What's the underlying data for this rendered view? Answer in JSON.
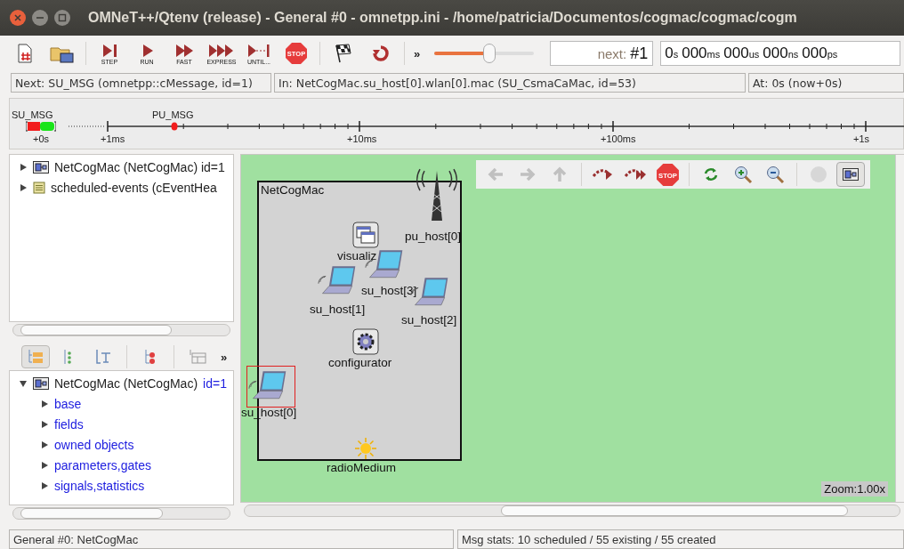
{
  "window": {
    "title": "OMNeT++/Qtenv (release) - General #0 - omnetpp.ini - /home/patricia/Documentos/cogmac/cogmac/cogm"
  },
  "toolbar": {
    "buttons": [
      {
        "kind": "rebuild"
      },
      {
        "kind": "load"
      },
      {
        "kind": "step",
        "label": "STEP"
      },
      {
        "kind": "run",
        "label": "RUN"
      },
      {
        "kind": "fast",
        "label": "FAST"
      },
      {
        "kind": "express",
        "label": "EXPRESS"
      },
      {
        "kind": "until",
        "label": "UNTIL..."
      },
      {
        "kind": "stop",
        "label": "STOP"
      },
      {
        "kind": "finish"
      },
      {
        "kind": "restart"
      }
    ],
    "more": "»",
    "speed": {
      "level": 0.55
    },
    "event": {
      "prefix": "next:",
      "value": "#1"
    },
    "sim_time": [
      {
        "value": "0",
        "unit": "s"
      },
      {
        "value": "000",
        "unit": "ms"
      },
      {
        "value": "000",
        "unit": "us"
      },
      {
        "value": "000",
        "unit": "ns"
      },
      {
        "value": "000",
        "unit": "ps"
      }
    ]
  },
  "info_bar": [
    "Next: SU_MSG (omnetpp::cMessage, id=1)",
    "In: NetCogMac.su_host[0].wlan[0].mac (SU_CsmaCaMac, id=53)",
    "At: 0s (now+0s)"
  ],
  "timeline": {
    "messages": [
      {
        "label": "SU_MSG",
        "kind": "bracket"
      },
      {
        "label": "PU_MSG",
        "kind": "dot"
      }
    ],
    "ticks": [
      "+0s",
      "+1ms",
      "+10ms",
      "+100ms",
      "+1s"
    ]
  },
  "object_tree": [
    {
      "kind": "module",
      "label": "NetCogMac (NetCogMac) id=1",
      "expanded": false
    },
    {
      "kind": "queue",
      "label": "scheduled-events (cEventHea",
      "expanded": false
    }
  ],
  "inspector_toolbar": {
    "buttons": [
      {
        "kind": "children",
        "selected": true
      },
      {
        "kind": "flat",
        "selected": false
      },
      {
        "kind": "inheritance",
        "selected": false
      },
      {
        "kind": "group",
        "selected": false
      },
      {
        "kind": "layout",
        "selected": false
      }
    ],
    "more": "»"
  },
  "inspector_tree": {
    "label": "NetCogMac (NetCogMac)",
    "detail": "id=1",
    "expanded": true,
    "children": [
      {
        "label": "base",
        "expanded": false
      },
      {
        "label": "fields",
        "expanded": false
      },
      {
        "label": "owned objects",
        "expanded": false
      },
      {
        "label": "parameters,gates",
        "expanded": false
      },
      {
        "label": "signals,statistics",
        "expanded": false
      }
    ]
  },
  "canvas_toolbar": {
    "buttons": [
      {
        "kind": "back",
        "disabled": true,
        "pressed": false
      },
      {
        "kind": "forward",
        "disabled": true,
        "pressed": false
      },
      {
        "kind": "up",
        "disabled": true,
        "pressed": false
      },
      {
        "kind": "step_into",
        "disabled": false,
        "pressed": false
      },
      {
        "kind": "step_fast",
        "disabled": false,
        "pressed": false
      },
      {
        "kind": "stop",
        "label": "STOP",
        "disabled": false,
        "pressed": false
      },
      {
        "kind": "refresh",
        "disabled": false,
        "pressed": false
      },
      {
        "kind": "zoom_in",
        "disabled": false,
        "pressed": false
      },
      {
        "kind": "zoom_out",
        "disabled": false,
        "pressed": false
      },
      {
        "kind": "ball",
        "disabled": true,
        "pressed": false
      },
      {
        "kind": "module",
        "disabled": false,
        "pressed": true
      }
    ]
  },
  "network": {
    "name": "NetCogMac",
    "zoom": "Zoom:1.00x",
    "nodes": [
      {
        "kind": "tower",
        "label": "pu_host[0]",
        "selected": false
      },
      {
        "kind": "window",
        "label": "visualiz",
        "selected": false
      },
      {
        "kind": "laptop",
        "label": "su_host[3]",
        "selected": false
      },
      {
        "kind": "laptop",
        "label": "su_host[1]",
        "selected": false
      },
      {
        "kind": "laptop",
        "label": "su_host[2]",
        "selected": false
      },
      {
        "kind": "gear",
        "label": "configurator",
        "selected": false
      },
      {
        "kind": "laptop",
        "label": "su_host[0]",
        "selected": true
      },
      {
        "kind": "sun",
        "label": "radioMedium",
        "selected": false
      }
    ]
  },
  "status_bar": [
    "General #0: NetCogMac",
    "Msg stats: 10 scheduled / 55 existing / 55 created"
  ]
}
